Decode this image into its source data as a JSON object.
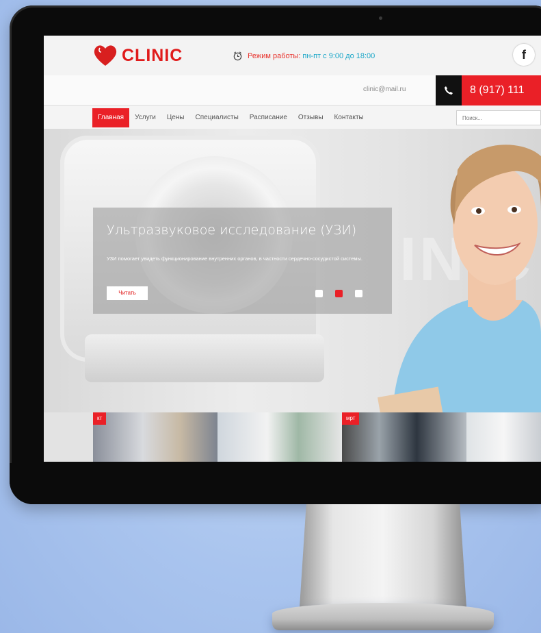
{
  "site": {
    "logo_text": "CLINIC",
    "hours_label": "Режим работы:",
    "hours_value": "пн-пт с 9:00 до 18:00",
    "facebook_label": "f",
    "email": "clinic@mail.ru",
    "phone": "8 (917) 111",
    "accent_color": "#ea2027",
    "secondary_color": "#16a5c7"
  },
  "nav": {
    "items": [
      {
        "label": "Главная",
        "active": true
      },
      {
        "label": "Услуги"
      },
      {
        "label": "Цены"
      },
      {
        "label": "Специалисты"
      },
      {
        "label": "Расписание"
      },
      {
        "label": "Отзывы"
      },
      {
        "label": "Контакты"
      }
    ],
    "search_placeholder": "Поиск..."
  },
  "hero": {
    "title": "Ультразвуковое исследование (УЗИ)",
    "text": "УЗИ помогает увидеть функционирование внутренних органов, в частности сердечно-сосудистой системы.",
    "button_label": "Читать",
    "slides_count": 3,
    "active_slide": 2,
    "watermark": "INIC"
  },
  "thumbnails": [
    {
      "badge": "кт"
    },
    {
      "badge": ""
    },
    {
      "badge": "мрт"
    },
    {
      "badge": ""
    }
  ]
}
